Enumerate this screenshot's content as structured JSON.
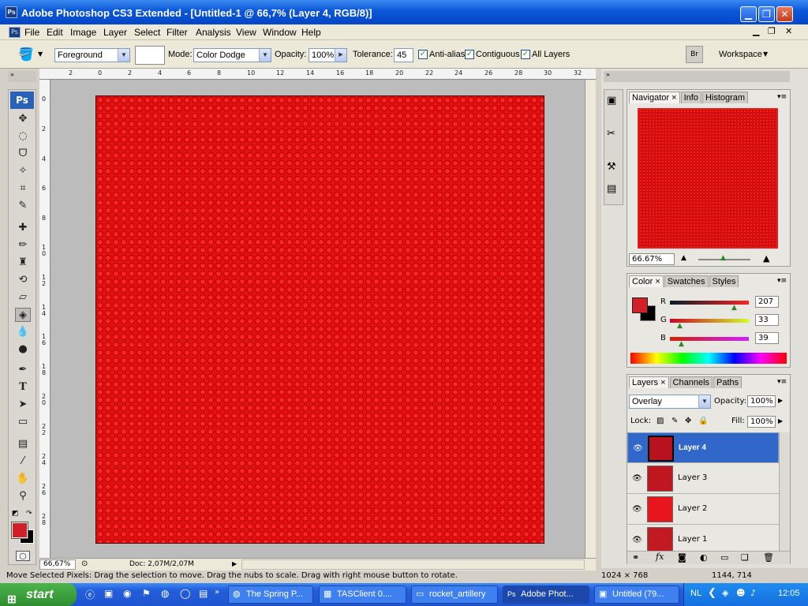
{
  "window": {
    "title": "Adobe Photoshop CS3 Extended - [Untitled-1 @ 66,7% (Layer 4, RGB/8)]",
    "app_icon": "Ps"
  },
  "menu": [
    "File",
    "Edit",
    "Image",
    "Layer",
    "Select",
    "Filter",
    "Analysis",
    "View",
    "Window",
    "Help"
  ],
  "options": {
    "fill_source": "Foreground",
    "mode_label": "Mode:",
    "mode_value": "Color Dodge",
    "opacity_label": "Opacity:",
    "opacity_value": "100%",
    "tolerance_label": "Tolerance:",
    "tolerance_value": "45",
    "antialias": "Anti-alias",
    "contiguous": "Contiguous",
    "all_layers": "All Layers",
    "workspace": "Workspace"
  },
  "ruler_top": [
    "2",
    "0",
    "2",
    "4",
    "6",
    "8",
    "10",
    "12",
    "14",
    "16",
    "18",
    "20",
    "22",
    "24",
    "26",
    "28",
    "30",
    "32"
  ],
  "ruler_left": [
    "0",
    "2",
    "4",
    "6",
    "8",
    "1 0",
    "1 2",
    "1 4",
    "1 6",
    "1 8",
    "2 0",
    "2 2",
    "2 4",
    "2 6",
    "2 8"
  ],
  "toolbox": {
    "logo": "Ps"
  },
  "status": {
    "zoom": "66,67%",
    "doc": "Doc: 2,07M/2,07M"
  },
  "hint": "Move Selected Pixels: Drag the selection to move. Drag the nubs to scale. Drag with right mouse button to rotate.",
  "hint_right": "1024 × 768",
  "hint_coords": "1144, 714",
  "navigator": {
    "tabs": [
      "Navigator",
      "Info",
      "Histogram"
    ],
    "zoom": "66.67%"
  },
  "color": {
    "tabs": [
      "Color",
      "Swatches",
      "Styles"
    ],
    "r_label": "R",
    "g_label": "G",
    "b_label": "B",
    "r": "207",
    "g": "33",
    "b": "39",
    "fg": "#cf2127"
  },
  "layers": {
    "tabs": [
      "Layers",
      "Channels",
      "Paths"
    ],
    "blend": "Overlay",
    "opacity_label": "Opacity:",
    "opacity": "100%",
    "lock_label": "Lock:",
    "fill_label": "Fill:",
    "fill": "100%",
    "items": [
      {
        "name": "Layer 4",
        "color": "#b8121e"
      },
      {
        "name": "Layer 3",
        "color": "#c0161f"
      },
      {
        "name": "Layer 2",
        "color": "#e8161c"
      },
      {
        "name": "Layer 1",
        "color": "#c11a22"
      }
    ]
  },
  "taskbar": {
    "start": "start",
    "tasks": [
      "The Spring P...",
      "TASClient 0....",
      "rocket_artillery",
      "Adobe Phot...",
      "Untitled (79..."
    ],
    "lang": "NL",
    "clock": "12:05"
  }
}
